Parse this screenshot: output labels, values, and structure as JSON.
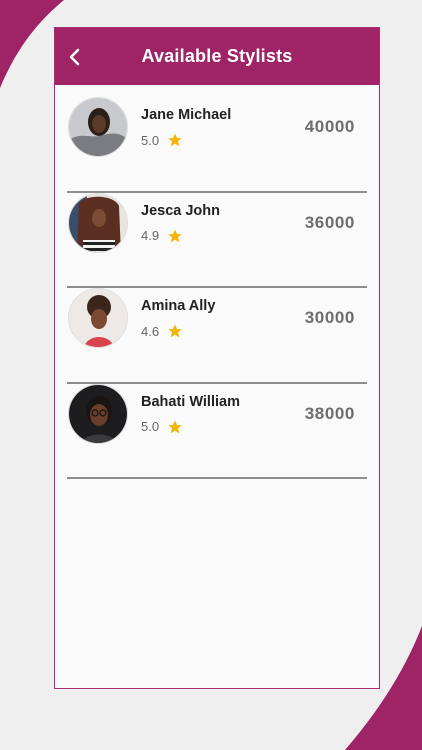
{
  "header": {
    "title": "Available Stylists"
  },
  "stylists": [
    {
      "name": "Jane Michael",
      "rating": "5.0",
      "price": "40000"
    },
    {
      "name": "Jesca John",
      "rating": "4.9",
      "price": "36000"
    },
    {
      "name": "Amina Ally",
      "rating": "4.6",
      "price": "30000"
    },
    {
      "name": "Bahati William",
      "rating": "5.0",
      "price": "38000"
    }
  ],
  "colors": {
    "brand": "#9e2465",
    "star": "#f2b705",
    "divider": "#8e8e8e"
  },
  "icons": {
    "back": "chevron-left-icon",
    "rating": "star-icon"
  }
}
